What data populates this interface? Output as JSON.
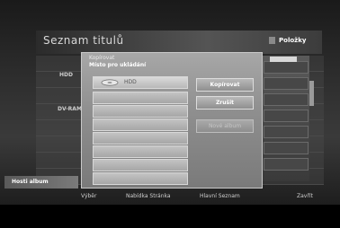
{
  "header": {
    "title": "Seznam titulů",
    "right_label": "Položky"
  },
  "background": {
    "row_labels": [
      "HDD",
      "DV-RAM"
    ],
    "bottom_left_label": "Hosti album"
  },
  "dialog": {
    "title": "Kopírovat",
    "subtitle": "Místo pro ukládání",
    "slots": [
      {
        "label": "HDD",
        "selected": true
      },
      {
        "label": ""
      },
      {
        "label": ""
      },
      {
        "label": ""
      },
      {
        "label": ""
      },
      {
        "label": ""
      },
      {
        "label": ""
      },
      {
        "label": ""
      }
    ],
    "buttons": {
      "copy": "Kopírovat",
      "cancel": "Zrušit",
      "new_album": "Nové album"
    }
  },
  "footer": {
    "item1": "Výběr",
    "item2": "Nabídka Stránka",
    "item3": "Hlavní Seznam",
    "item4": "Zavřít"
  }
}
